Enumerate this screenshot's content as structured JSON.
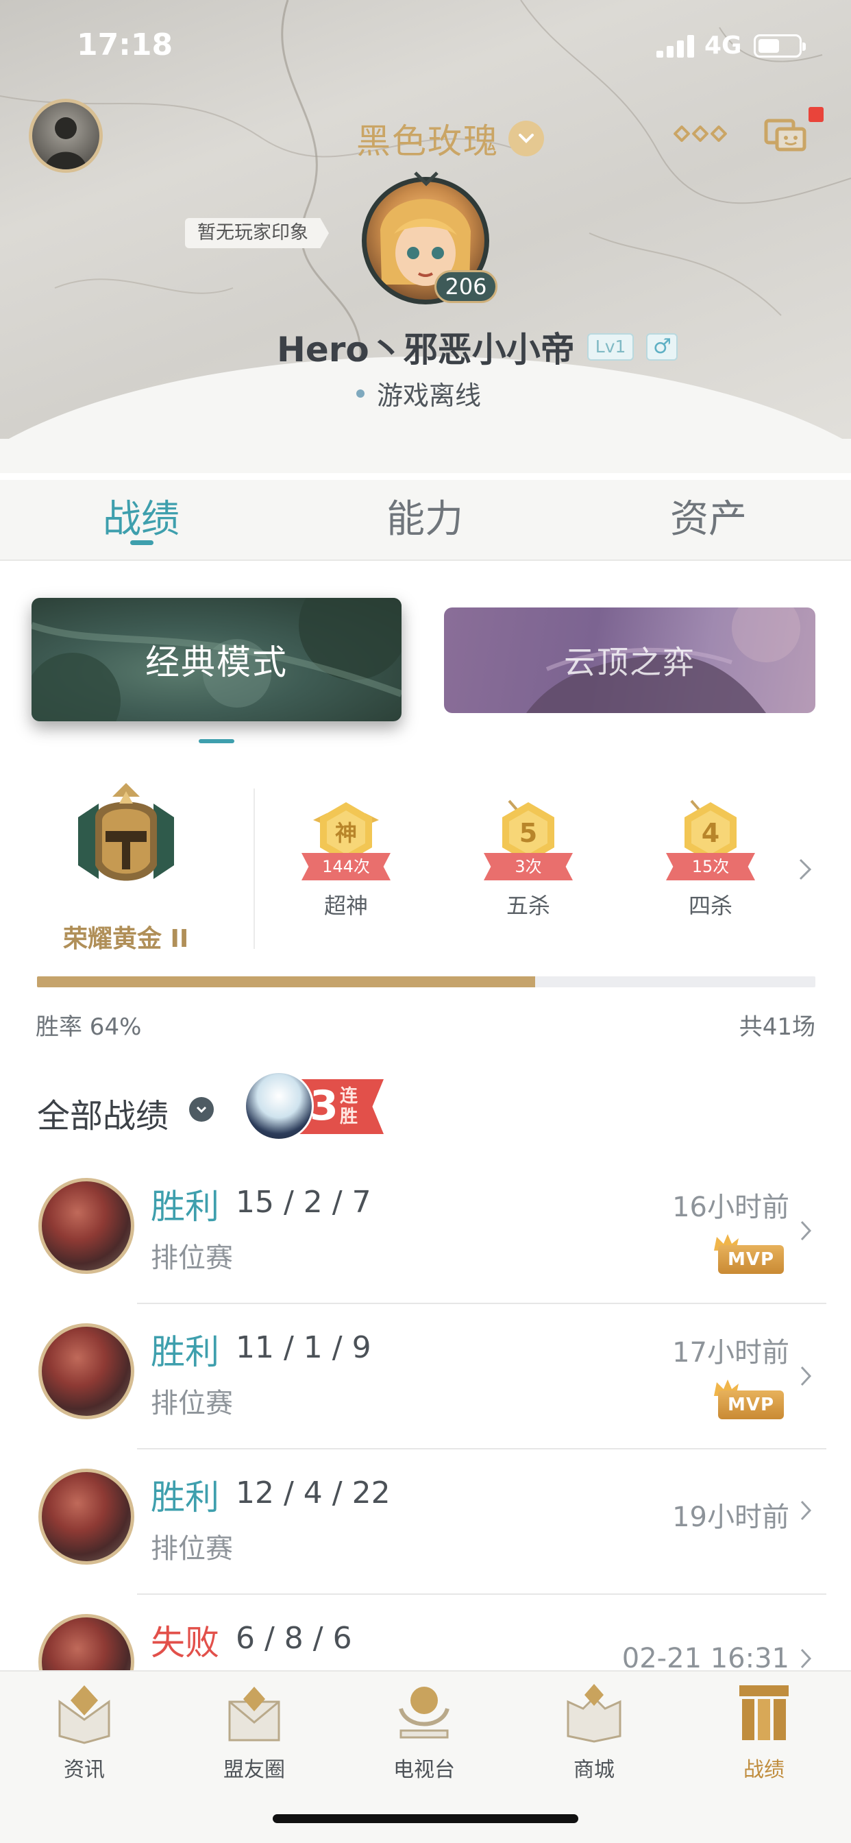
{
  "status_bar": {
    "time": "17:18",
    "network": "4G"
  },
  "header": {
    "nickname": "黑色玫瑰",
    "impression": "暂无玩家印象",
    "level": "206",
    "player_name": "Hero丶邪恶小小帝",
    "lv_tag": "Lv1",
    "sex_tag": "♂",
    "online_status": "游戏离线"
  },
  "tabs": [
    {
      "label": "战绩",
      "active": true
    },
    {
      "label": "能力",
      "active": false
    },
    {
      "label": "资产",
      "active": false
    }
  ],
  "modes": {
    "classic": "经典模式",
    "tft": "云顶之弈"
  },
  "rank": {
    "name": "荣耀黄金 II"
  },
  "achievements": [
    {
      "glyph": "神",
      "count": "144次",
      "name": "超神"
    },
    {
      "glyph": "5",
      "count": "3次",
      "name": "五杀"
    },
    {
      "glyph": "4",
      "count": "15次",
      "name": "四杀"
    }
  ],
  "stats": {
    "win_rate_label": "胜率 64%",
    "win_rate": 0.64,
    "total_label": "共41场"
  },
  "records": {
    "title": "全部战绩",
    "streak": {
      "number": "3",
      "text": "连胜"
    }
  },
  "matches": [
    {
      "result": "胜利",
      "outcome": "win",
      "kda": "15 / 2 / 7",
      "type": "排位赛",
      "time": "16小时前",
      "mvp": "MVP"
    },
    {
      "result": "胜利",
      "outcome": "win",
      "kda": "11 / 1 / 9",
      "type": "排位赛",
      "time": "17小时前",
      "mvp": "MVP"
    },
    {
      "result": "胜利",
      "outcome": "win",
      "kda": "12 / 4 / 22",
      "type": "排位赛",
      "time": "19小时前",
      "mvp": ""
    },
    {
      "result": "失败",
      "outcome": "lose",
      "kda": "6 / 8 / 6",
      "type": "",
      "time": "02-21 16:31",
      "mvp": ""
    }
  ],
  "bottom_nav": [
    {
      "label": "资讯",
      "icon": "news-icon",
      "active": false
    },
    {
      "label": "盟友圈",
      "icon": "friends-icon",
      "active": false
    },
    {
      "label": "电视台",
      "icon": "tv-icon",
      "active": false
    },
    {
      "label": "商城",
      "icon": "shop-icon",
      "active": false
    },
    {
      "label": "战绩",
      "icon": "records-icon",
      "active": true
    }
  ],
  "colors": {
    "accent": "#3e9fad",
    "gold": "#c5a36b",
    "win": "#3e9fad",
    "lose": "#e2504a"
  }
}
